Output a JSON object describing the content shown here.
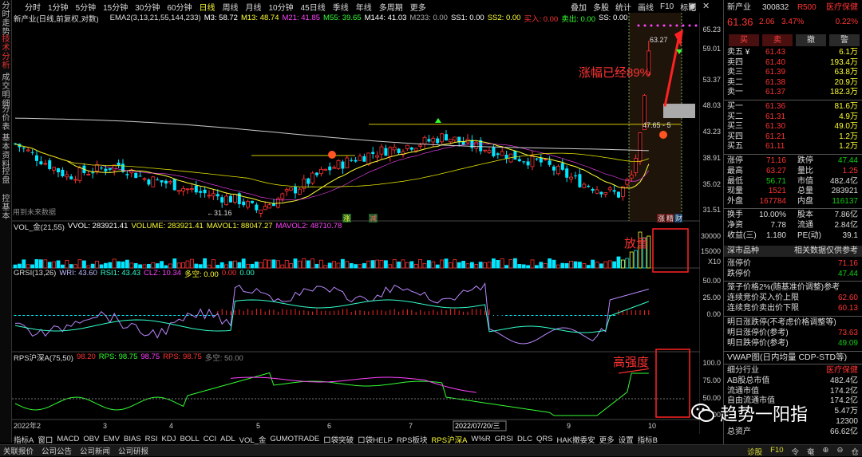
{
  "left_tabs": [
    {
      "label": "分时走势",
      "active": false
    },
    {
      "label": "技术分析",
      "active": true
    },
    {
      "label": "成交明细",
      "active": false
    },
    {
      "label": "分价表",
      "active": false
    },
    {
      "label": "基本资料",
      "active": false
    },
    {
      "label": "控盘",
      "active": false
    },
    {
      "label": "控基本",
      "active": false
    }
  ],
  "periods": [
    {
      "label": "分时",
      "active": false
    },
    {
      "label": "1分钟",
      "active": false
    },
    {
      "label": "5分钟",
      "active": false
    },
    {
      "label": "15分钟",
      "active": false
    },
    {
      "label": "30分钟",
      "active": false
    },
    {
      "label": "60分钟",
      "active": false
    },
    {
      "label": "日线",
      "active": true
    },
    {
      "label": "周线",
      "active": false
    },
    {
      "label": "月线",
      "active": false
    },
    {
      "label": "10分钟",
      "active": false
    },
    {
      "label": "45日线",
      "active": false
    },
    {
      "label": "季线",
      "active": false
    },
    {
      "label": "年线",
      "active": false
    },
    {
      "label": "多周期",
      "active": false
    },
    {
      "label": "更多",
      "active": false
    }
  ],
  "toolbar": [
    "叠加",
    "多股",
    "统计",
    "画线",
    "F10",
    "标记"
  ],
  "main_chart": {
    "title": "新产业(日线,前复权,对数)",
    "indicator": "EMA2(3,13,21,55,144,233)",
    "values": [
      {
        "text": "M3: 58.72",
        "color": "#ffffff"
      },
      {
        "text": "M13: 48.74",
        "color": "#ffff33"
      },
      {
        "text": "M21: 41.85",
        "color": "#ff44ff"
      },
      {
        "text": "M55: 39.65",
        "color": "#33ff33"
      },
      {
        "text": "M144: 41.03",
        "color": "#ffffff"
      },
      {
        "text": "M233: 0.00",
        "color": "#aaaaaa"
      },
      {
        "text": "SS1: 0.00",
        "color": "#ffffff"
      },
      {
        "text": "SS2: 0.00",
        "color": "#ffff33"
      },
      {
        "text": "买入: 0.00",
        "color": "#ff3333"
      },
      {
        "text": "卖出: 0.00",
        "color": "#33ff33"
      },
      {
        "text": "SS: 0.00",
        "color": "#ffffff"
      }
    ],
    "y_ticks": [
      "65.23",
      "59.01",
      "53.37",
      "48.03",
      "43.23",
      "38.91",
      "35.02",
      "31.51"
    ],
    "high_label": "63.27",
    "low_label": "31.16",
    "level_label": "47.65 - 5",
    "future_note": "用到未来数据",
    "badges": [
      "涨",
      "减"
    ],
    "badges_right": [
      "涨",
      "精",
      "财"
    ],
    "annotation": "涨幅已经89%"
  },
  "volume": {
    "title": "VOL_金(21,55)",
    "values": [
      {
        "text": "VVOL: 283921.41",
        "color": "#ffffff"
      },
      {
        "text": "VOLUME: 283921.41",
        "color": "#ffff33"
      },
      {
        "text": "MAVOL1: 88047.27",
        "color": "#ffff33"
      },
      {
        "text": "MAVOL2: 48710.78",
        "color": "#ff44ff"
      }
    ],
    "y_ticks": [
      "30000",
      "15000",
      "X10"
    ],
    "annotation": "放量"
  },
  "grsi": {
    "title": "GRSI(13,26)",
    "values": [
      {
        "text": "WRI: 43.60",
        "color": "#bbbbff"
      },
      {
        "text": "RSI1: 43.43",
        "color": "#33ffcc"
      },
      {
        "text": "CLZ: 10.34",
        "color": "#ff44ff"
      },
      {
        "text": "多空: 0.00",
        "color": "#ffff33"
      },
      {
        "text": "0.00",
        "color": "#ff3333"
      },
      {
        "text": "0.00",
        "color": "#33ffcc"
      }
    ],
    "y_ticks": [
      "50.00",
      "25.00",
      "0.00"
    ]
  },
  "rps": {
    "title": "RPS沪深A(75,50)",
    "values": [
      {
        "text": "RPS: 98.75",
        "color": "#33ff33"
      },
      {
        "text": "98.75",
        "color": "#ff44ff"
      },
      {
        "text": "RPS: 98.75",
        "color": "#ff3333"
      },
      {
        "text": "多空: 50.00",
        "color": "#888888"
      }
    ],
    "first": {
      "text": "98.20",
      "color": "#ff3333"
    },
    "y_ticks": [
      "100.0",
      "75.00",
      "50.00",
      "25.00"
    ],
    "annotation": "高强度"
  },
  "x_axis": [
    "2022年2",
    "3",
    "4",
    "5",
    "6",
    "7",
    "2022/07/20/三",
    "9",
    "10"
  ],
  "bottom_tabs": [
    {
      "label": "指标A",
      "active": false
    },
    {
      "label": "窗口",
      "active": false
    },
    {
      "label": "MACD",
      "active": false
    },
    {
      "label": "OBV",
      "active": false
    },
    {
      "label": "EMV",
      "active": false
    },
    {
      "label": "BIAS",
      "active": false
    },
    {
      "label": "RSI",
      "active": false
    },
    {
      "label": "KDJ",
      "active": false
    },
    {
      "label": "BOLL",
      "active": false
    },
    {
      "label": "CCI",
      "active": false
    },
    {
      "label": "ADL",
      "active": false
    },
    {
      "label": "VOL_金",
      "active": false
    },
    {
      "label": "GUMOTRADE",
      "active": false
    },
    {
      "label": "口袋突破",
      "active": false
    },
    {
      "label": "口袋HELP",
      "active": false
    },
    {
      "label": "RPS板块",
      "active": false
    },
    {
      "label": "RPS沪深A",
      "active": true
    },
    {
      "label": "W%R",
      "active": false
    },
    {
      "label": "GRSI",
      "active": false
    },
    {
      "label": "DLC",
      "active": false
    },
    {
      "label": "QRS",
      "active": false
    },
    {
      "label": "HAK撤委安",
      "active": false
    },
    {
      "label": "更多",
      "active": false
    },
    {
      "label": "设置",
      "active": false
    },
    {
      "label": "指标B",
      "active": false
    }
  ],
  "status_bar": [
    "关联报价",
    "公司公告",
    "公司新闻",
    "公司研报"
  ],
  "status_right": [
    "诊股",
    "F10",
    "令",
    "奄",
    "⊕",
    "⊖",
    "仓"
  ],
  "quote": {
    "name": "新产业",
    "code": "300832",
    "flag": "R",
    "index": "500",
    "tag": "医疗保健",
    "price": "61.36",
    "change": "2.06",
    "pct": "3.47%",
    "side_pct": "0.22%",
    "buttons": [
      "买",
      "卖",
      "撤",
      "警"
    ],
    "sell": [
      {
        "label": "卖五 ¥",
        "price": "61.43",
        "vol": "6.1万"
      },
      {
        "label": "卖四",
        "price": "61.40",
        "vol": "193.4万"
      },
      {
        "label": "卖三",
        "price": "61.39",
        "vol": "63.8万"
      },
      {
        "label": "卖二",
        "price": "61.38",
        "vol": "20.9万"
      },
      {
        "label": "卖一",
        "price": "61.37",
        "vol": "182.3万"
      }
    ],
    "buy": [
      {
        "label": "买一",
        "price": "61.36",
        "vol": "81.6万"
      },
      {
        "label": "买二",
        "price": "61.31",
        "vol": "4.9万"
      },
      {
        "label": "买三",
        "price": "61.30",
        "vol": "49.0万"
      },
      {
        "label": "买四",
        "price": "61.21",
        "vol": "1.2万"
      },
      {
        "label": "买五",
        "price": "61.11",
        "vol": "1.2万"
      }
    ],
    "stats": [
      {
        "l1": "涨停",
        "v1": "71.16",
        "c1": "red",
        "l2": "跌停",
        "v2": "47.44",
        "c2": "grn"
      },
      {
        "l1": "最高",
        "v1": "63.27",
        "c1": "red",
        "l2": "量比",
        "v2": "1.25",
        "c2": "red"
      },
      {
        "l1": "最低",
        "v1": "56.71",
        "c1": "grn",
        "l2": "市值",
        "v2": "482.4亿",
        "c2": "wht"
      },
      {
        "l1": "现量",
        "v1": "1521",
        "c1": "red",
        "l2": "总量",
        "v2": "283921",
        "c2": "wht"
      },
      {
        "l1": "外盘",
        "v1": "167784",
        "c1": "red",
        "l2": "内盘",
        "v2": "116137",
        "c2": "grn"
      },
      {
        "l1": "换手",
        "v1": "10.00%",
        "c1": "wht",
        "l2": "股本",
        "v2": "7.86亿",
        "c2": "wht"
      },
      {
        "l1": "净资",
        "v1": "7.78",
        "c1": "wht",
        "l2": "流通",
        "v2": "2.84亿",
        "c2": "wht"
      },
      {
        "l1": "收益(三)",
        "v1": "1.180",
        "c1": "wht",
        "l2": "PE(动)",
        "v2": "39.1",
        "c2": "wht"
      }
    ],
    "section_left": "深市品种",
    "section_right": "相关数据仅供参考",
    "limits": [
      {
        "l": "涨停价",
        "v": "71.16",
        "c": "red"
      },
      {
        "l": "跌停价",
        "v": "47.44",
        "c": "grn"
      }
    ],
    "cage": "笼子价格2%(随基准价调整)参考",
    "cage_rows": [
      {
        "l": "连续竞价买入价上限",
        "v": "62.60",
        "c": "red"
      },
      {
        "l": "连续竞价卖出价下限",
        "v": "60.13",
        "c": "red"
      }
    ],
    "tomorrow": "明日涨跌停(不考虑价格调整等)",
    "tomorrow_rows": [
      {
        "l": "明日涨停价(参考)",
        "v": "73.63",
        "c": "red"
      },
      {
        "l": "明日跌停价(参考)",
        "v": "49.09",
        "c": "grn"
      }
    ],
    "vwap": "VWAP图(日内均量 CDP-STD等)",
    "info": [
      {
        "l": "细分行业",
        "v": "医疗保健",
        "c": "red"
      },
      {
        "l": "AB股总市值",
        "v": "482.4亿",
        "c": "wht"
      },
      {
        "l": "流通市值",
        "v": "174.2亿",
        "c": "wht"
      },
      {
        "l": "自由流通市值",
        "v": "174.2亿",
        "c": "wht"
      },
      {
        "l": "",
        "v": "5.47万",
        "c": "wht"
      },
      {
        "l": "",
        "v": "12300",
        "c": "wht"
      },
      {
        "l": "总资产",
        "v": "66.62亿",
        "c": "wht"
      }
    ]
  },
  "watermark": "趋势一阳指"
}
